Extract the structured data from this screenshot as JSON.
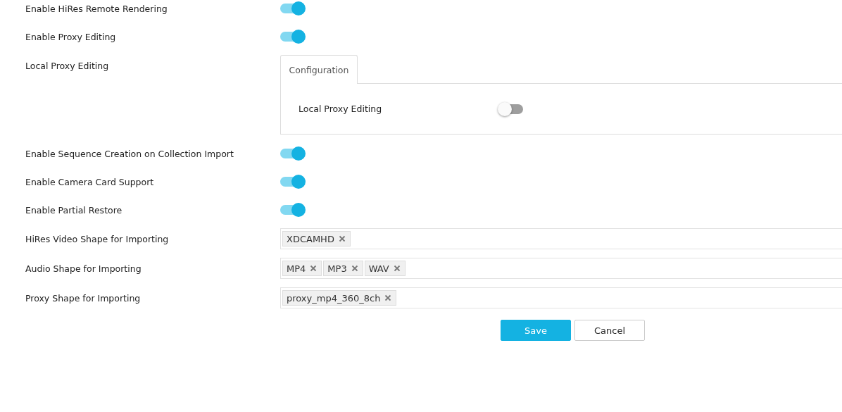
{
  "settings": [
    {
      "kind": "toggle",
      "label": "Enable HiRes Remote Rendering",
      "on": true
    },
    {
      "kind": "toggle",
      "label": "Enable Proxy Editing",
      "on": true
    },
    {
      "kind": "panel",
      "label": "Local Proxy Editing",
      "tabs": [
        {
          "label": "Configuration",
          "selected": true
        }
      ],
      "settings": [
        {
          "label": "Local Proxy Editing",
          "on": false
        }
      ]
    },
    {
      "kind": "toggle",
      "label": "Enable Sequence Creation on Collection Import",
      "on": true
    },
    {
      "kind": "toggle",
      "label": "Enable Camera Card Support",
      "on": true
    },
    {
      "kind": "toggle",
      "label": "Enable Partial Restore",
      "on": true
    },
    {
      "kind": "tags",
      "label": "HiRes Video Shape for Importing",
      "tags": [
        "XDCAMHD"
      ]
    },
    {
      "kind": "tags",
      "label": "Audio Shape for Importing",
      "tags": [
        "MP4",
        "MP3",
        "WAV"
      ]
    },
    {
      "kind": "tags",
      "label": "Proxy Shape for Importing",
      "tags": [
        "proxy_mp4_360_8ch"
      ]
    }
  ],
  "buttons": [
    {
      "label": "Save",
      "kind": "primary"
    },
    {
      "label": "Cancel",
      "kind": "secondary"
    }
  ]
}
